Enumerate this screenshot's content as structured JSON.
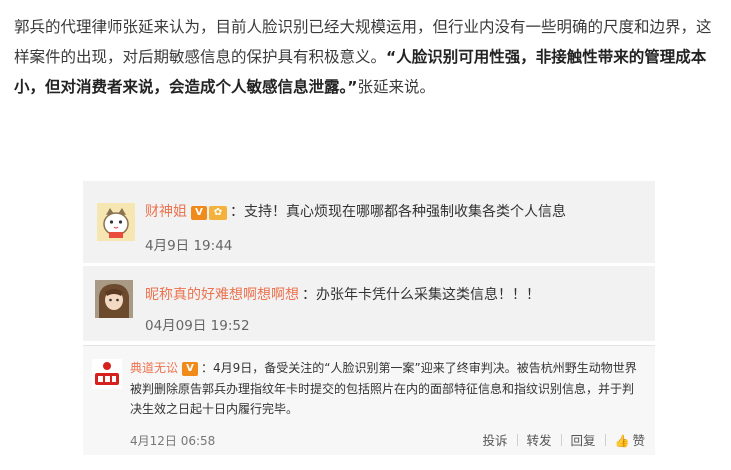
{
  "article": {
    "para_plain": "郭兵的代理律师张延来认为，目前人脸识别已经大规模运用，但行业内没有一些明确的尺度和边界，这样案件的出现，对后期敏感信息的保护具有积极意义。",
    "para_quote": "“人脸识别可用性强，非接触性带来的管理成本小，但对消费者来说，会造成个人敏感信息泄露。”",
    "para_tail": "张延来说。"
  },
  "comments": [
    {
      "username": "财神姐",
      "badge_v": "V",
      "badge_icon": "vip-badge-icon",
      "text": "支持！真心烦现在哪哪都各种强制收集各类个人信息",
      "time": "4月9日 19:44"
    },
    {
      "username": "昵称真的好难想啊想啊想",
      "text": "办张年卡凭什么采集这类信息！！！",
      "time": "04月09日 19:52"
    },
    {
      "username": "典道无讼",
      "badge_v": "V",
      "text": "4月9日，备受关注的“人脸识别第一案”迎来了终审判决。被告杭州野生动物世界被判删除原告郭兵办理指纹年卡时提交的包括照片在内的面部特征信息和指纹识别信息，并于判决生效之日起十日内履行完毕。",
      "time": "4月12日 06:58",
      "actions": {
        "report": "投诉",
        "forward": "转发",
        "reply": "回复",
        "like": "赞"
      }
    }
  ],
  "colors": {
    "username": "#eb7350",
    "card_bg": "#f2f2f2",
    "badge_orange": "#f08a1b"
  }
}
